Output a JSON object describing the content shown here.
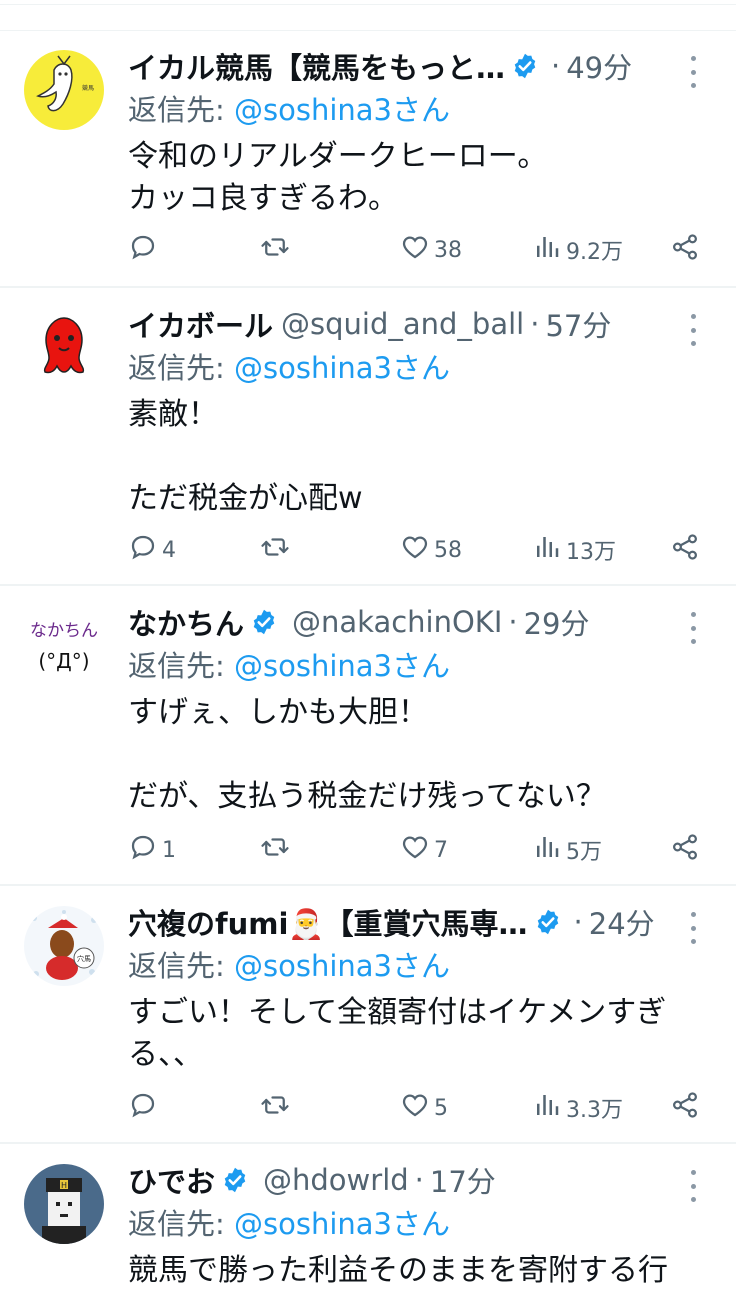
{
  "posts": [
    {
      "name": "イカル競馬【競馬をもっと…",
      "verified": true,
      "handle": "",
      "time": "49分",
      "reply_prefix": "返信先: ",
      "reply_to": "@soshina3さん",
      "text": "令和のリアルダークヒーロー。\nカッコ良すぎるわ。",
      "replies": "",
      "reposts": "",
      "likes": "38",
      "views": "9.2万",
      "avatar_icon": "ikaru-avatar"
    },
    {
      "name": "イカボール",
      "verified": false,
      "handle": "@squid_and_ball",
      "time": "57分",
      "reply_prefix": "返信先: ",
      "reply_to": "@soshina3さん",
      "text": "素敵！\n\nただ税金が心配w",
      "replies": "4",
      "reposts": "",
      "likes": "58",
      "views": "13万",
      "avatar_icon": "red-squid-avatar"
    },
    {
      "name": "なかちん",
      "verified": true,
      "handle": "@nakachinOKI",
      "time": "29分",
      "reply_prefix": "返信先: ",
      "reply_to": "@soshina3さん",
      "text": "すげぇ、しかも大胆！\n\nだが、支払う税金だけ残ってない？",
      "replies": "1",
      "reposts": "",
      "likes": "7",
      "views": "5万",
      "avatar_icon": "nakachin-face-avatar",
      "avatar_text": "なかちん",
      "avatar_face": "(°Д°)"
    },
    {
      "name": "穴複のfumi🎅【重賞穴馬専…",
      "verified": true,
      "handle": "",
      "time": "24分",
      "reply_prefix": "返信先: ",
      "reply_to": "@soshina3さん",
      "text": "すごい！そして全額寄付はイケメンすぎる、、",
      "replies": "",
      "reposts": "",
      "likes": "5",
      "views": "3.3万",
      "avatar_icon": "horse-santa-avatar",
      "avatar_text": "穴馬"
    },
    {
      "name": "ひでお",
      "verified": true,
      "handle": "@hdowrld",
      "time": "17分",
      "reply_prefix": "返信先: ",
      "reply_to": "@soshina3さん",
      "text": "競馬で勝った利益そのままを寄附する行",
      "replies": "",
      "reposts": "",
      "likes": "",
      "views": "",
      "avatar_icon": "pixel-hat-avatar",
      "avatar_text": "H"
    }
  ],
  "colors": {
    "link": "#1d9bf0",
    "secondary": "#536471",
    "divider": "#eff3f4",
    "text": "#0f1419"
  }
}
